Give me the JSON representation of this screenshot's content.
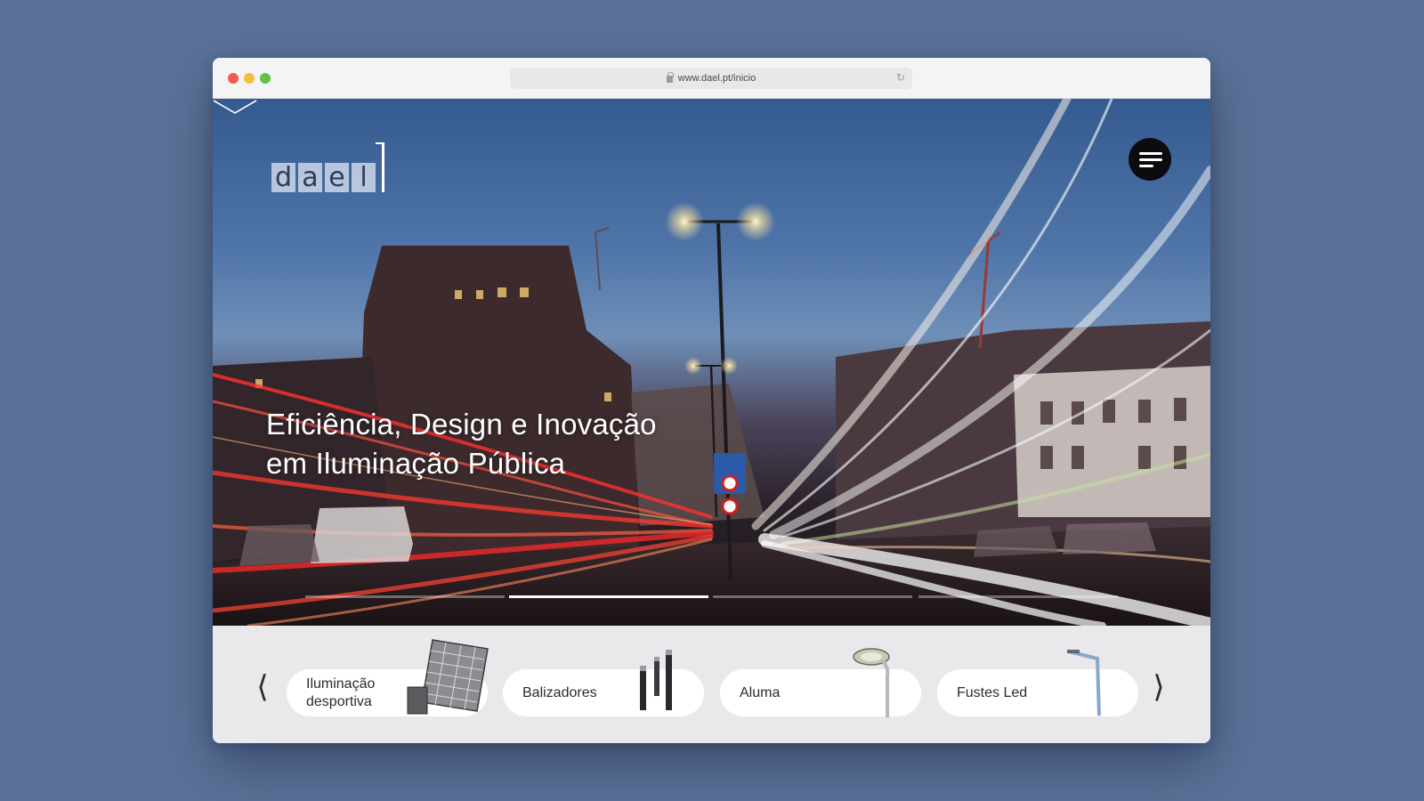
{
  "browser": {
    "url": "www.dael.pt/inicio"
  },
  "logo": {
    "letters": [
      "d",
      "a",
      "e",
      "l"
    ]
  },
  "hero": {
    "headline_line1": "Eficiência, Design e Inovação",
    "headline_line2": "em Iluminação Pública",
    "slides_total": 4,
    "active_slide": 2
  },
  "products": {
    "items": [
      {
        "label_line1": "Iluminação",
        "label_line2": "desportiva",
        "icon": "floodlight-icon"
      },
      {
        "label_line1": "Balizadores",
        "label_line2": "",
        "icon": "bollard-icon"
      },
      {
        "label_line1": "Aluma",
        "label_line2": "",
        "icon": "street-lamp-icon"
      },
      {
        "label_line1": "Fustes Led",
        "label_line2": "",
        "icon": "lamp-post-icon"
      }
    ]
  },
  "colors": {
    "desktop": "#5b7298",
    "menu_button": "#0c0c0e",
    "card_bg": "#ffffff",
    "strip_bg": "#e9e9eb"
  }
}
